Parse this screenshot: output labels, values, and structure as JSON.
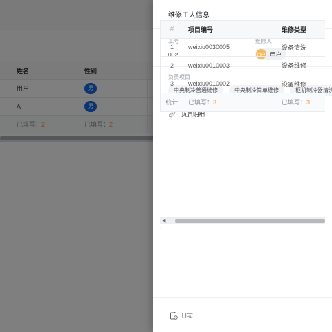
{
  "background_table": {
    "columns": [
      "姓名",
      "性别"
    ],
    "rows": [
      {
        "name": "用户",
        "gender": "男"
      },
      {
        "name": "A",
        "gender": "男"
      }
    ],
    "footer": {
      "name_filled_label": "已填写：",
      "name_filled_count": "2",
      "gender_filled_label": "已填写：",
      "gender_filled_count": "2"
    }
  },
  "drawer": {
    "title": "维修工人信息",
    "fields": {
      "employee_id_label": "工号",
      "employee_id_value": "002",
      "repairer_label": "维修人",
      "repairer_avatar": "用户",
      "repairer_name": "用户"
    },
    "projects": {
      "label": "负责项目",
      "tags": [
        "中央制冷普通维修",
        "中央制冷简单维修",
        "柜机制冷器清洗"
      ]
    },
    "detail": {
      "title": "负责明细",
      "columns": {
        "index": "#",
        "project_code": "项目编号",
        "repair_type": "维修类型"
      },
      "rows": [
        {
          "index": "1",
          "project_code": "weixiu0030005",
          "repair_type": "设备清洗"
        },
        {
          "index": "2",
          "project_code": "weixiu0010003",
          "repair_type": "设备维修"
        },
        {
          "index": "3",
          "project_code": "weixiu0010002",
          "repair_type": "设备维修"
        }
      ],
      "footer": {
        "label": "统计",
        "project_filled_label": "已填写：",
        "project_filled_count": "3",
        "type_filled_label": "已填写：",
        "type_filled_count": "3"
      }
    },
    "footer": {
      "log_label": "日志"
    }
  },
  "colors": {
    "accent_blue": "#1769e0",
    "count_orange": "#f29b38",
    "avatar_orange": "#f6b95e"
  }
}
